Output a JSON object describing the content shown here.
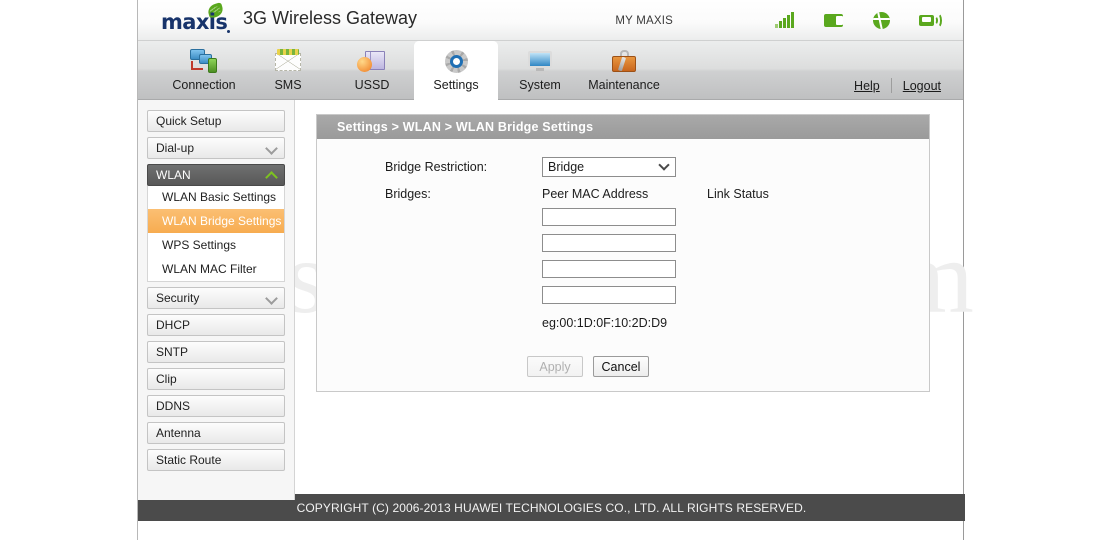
{
  "brand": {
    "logo_text": "maxis",
    "product_title": "3G Wireless Gateway",
    "account_label": "MY MAXIS",
    "status_icons": [
      {
        "name": "signal-strength-icon"
      },
      {
        "name": "sim-card-icon"
      },
      {
        "name": "globe-icon"
      },
      {
        "name": "wifi-broadcast-icon"
      }
    ]
  },
  "nav": {
    "tabs": [
      {
        "label": "Connection",
        "icon": "connection-icon",
        "active": false
      },
      {
        "label": "SMS",
        "icon": "envelope-icon",
        "active": false
      },
      {
        "label": "USSD",
        "icon": "ussd-icon",
        "active": false
      },
      {
        "label": "Settings",
        "icon": "gear-icon",
        "active": true
      },
      {
        "label": "System",
        "icon": "monitor-icon",
        "active": false
      },
      {
        "label": "Maintenance",
        "icon": "toolbox-icon",
        "active": false
      }
    ],
    "help_label": "Help",
    "logout_label": "Logout"
  },
  "sidebar": {
    "items": [
      {
        "label": "Quick Setup",
        "chevron": "none"
      },
      {
        "label": "Dial-up",
        "chevron": "down"
      },
      {
        "label": "WLAN",
        "chevron": "up",
        "expanded": true,
        "children": [
          {
            "label": "WLAN Basic Settings",
            "active": false
          },
          {
            "label": "WLAN Bridge Settings",
            "active": true
          },
          {
            "label": "WPS Settings",
            "active": false
          },
          {
            "label": "WLAN MAC Filter",
            "active": false
          }
        ]
      },
      {
        "label": "Security",
        "chevron": "down"
      },
      {
        "label": "DHCP",
        "chevron": "none"
      },
      {
        "label": "SNTP",
        "chevron": "none"
      },
      {
        "label": "Clip",
        "chevron": "none"
      },
      {
        "label": "DDNS",
        "chevron": "none"
      },
      {
        "label": "Antenna",
        "chevron": "none"
      },
      {
        "label": "Static Route",
        "chevron": "none"
      }
    ]
  },
  "content": {
    "breadcrumb": "Settings > WLAN > WLAN Bridge Settings",
    "bridge_restriction_label": "Bridge Restriction:",
    "bridge_restriction_value": "Bridge",
    "bridges_label": "Bridges:",
    "peer_mac_header": "Peer MAC Address",
    "link_status_header": "Link Status",
    "mac_fields": [
      {
        "value": "",
        "link_status": ""
      },
      {
        "value": "",
        "link_status": ""
      },
      {
        "value": "",
        "link_status": ""
      },
      {
        "value": "",
        "link_status": ""
      }
    ],
    "hint": "eg:00:1D:0F:10:2D:D9",
    "apply_label": "Apply",
    "cancel_label": "Cancel"
  },
  "watermark": "setupRouter.com",
  "footer": {
    "copyright": "COPYRIGHT (C) 2006-2013 HUAWEI TECHNOLOGIES CO., LTD. ALL RIGHTS RESERVED."
  },
  "colors": {
    "brand_blue": "#18346b",
    "brand_green": "#5aa81e",
    "active_orange": "#f7ac50",
    "crumb_gray": "#9a9a9a",
    "footer_gray": "#4b4b4b"
  }
}
